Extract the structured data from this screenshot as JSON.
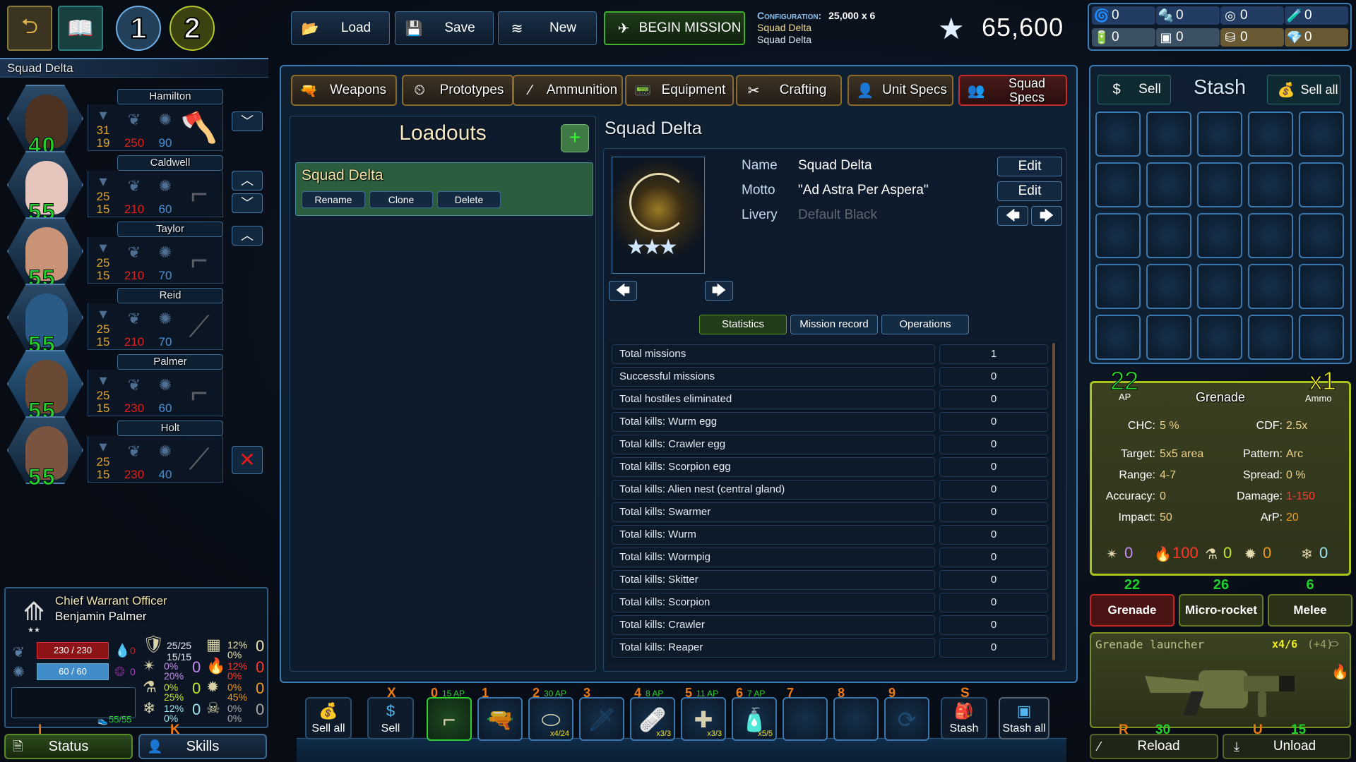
{
  "top_left": {
    "back_icon": "back-arrow-icon",
    "codex_icon": "book-icon",
    "squad_slots": [
      "1",
      "2"
    ]
  },
  "squad": {
    "name": "Squad Delta",
    "soldiers": [
      {
        "name": "Hamilton",
        "level": "40",
        "armor_top": "31",
        "armor_bottom": "19",
        "hp": "250",
        "psi": "90",
        "weapon": "axe",
        "controls": [
          "down"
        ]
      },
      {
        "name": "Caldwell",
        "level": "55",
        "armor_top": "25",
        "armor_bottom": "15",
        "hp": "210",
        "psi": "60",
        "weapon": "assault-rifle",
        "controls": [
          "up",
          "down"
        ]
      },
      {
        "name": "Taylor",
        "level": "55",
        "armor_top": "25",
        "armor_bottom": "15",
        "hp": "210",
        "psi": "70",
        "weapon": "smg",
        "controls": [
          "up"
        ]
      },
      {
        "name": "Reid",
        "level": "55",
        "armor_top": "25",
        "armor_bottom": "15",
        "hp": "210",
        "psi": "70",
        "weapon": "sniper-rifle",
        "controls": []
      },
      {
        "name": "Palmer",
        "level": "55",
        "armor_top": "25",
        "armor_bottom": "15",
        "hp": "230",
        "psi": "60",
        "weapon": "grenade-launcher",
        "controls": [],
        "selected": true
      },
      {
        "name": "Holt",
        "level": "55",
        "armor_top": "25",
        "armor_bottom": "15",
        "hp": "230",
        "psi": "40",
        "weapon": "rifle",
        "controls": [
          "remove"
        ]
      }
    ]
  },
  "officer": {
    "rank": "Chief Warrant Officer",
    "name": "Benjamin Palmer",
    "hp": "230 / 230",
    "psi": "60 / 60",
    "bleed": "0",
    "psi_damage": "0",
    "stamina": "55/55",
    "armor": [
      "25/25",
      "15/15"
    ],
    "resistances": [
      {
        "icon": "grid-icon",
        "a": "12%",
        "b": "0%",
        "v": "0",
        "color": "#f0e6b0"
      },
      {
        "icon": "burst-icon",
        "a": "0%",
        "b": "20%",
        "v": "0",
        "color": "#c38ef0"
      },
      {
        "icon": "fire-icon",
        "a": "12%",
        "b": "0%",
        "v": "0",
        "color": "#ff3a2a"
      },
      {
        "icon": "flask-icon",
        "a": "0%",
        "b": "25%",
        "v": "0",
        "color": "#c6e62a"
      },
      {
        "icon": "virus-icon",
        "a": "0%",
        "b": "45%",
        "v": "0",
        "color": "#f09a1a"
      },
      {
        "icon": "snowflake-icon",
        "a": "12%",
        "b": "0%",
        "v": "0",
        "color": "#9ee6f0"
      },
      {
        "icon": "skull-icon",
        "a": "0%",
        "b": "0%",
        "v": "0",
        "color": "#aaaaaa"
      }
    ]
  },
  "bottom_tabs": {
    "status": {
      "label": "Status",
      "hotkey": "I"
    },
    "skills": {
      "label": "Skills",
      "hotkey": "K"
    }
  },
  "toolbar": {
    "load": "Load",
    "save": "Save",
    "new": "New",
    "begin": "BEGIN MISSION",
    "config_label": "Configuration:",
    "config_value": "25,000 x 6",
    "config_line1": "Squad Delta",
    "config_line2": "Squad Delta",
    "credits": "65,600"
  },
  "resources": [
    {
      "icon": "coil-icon",
      "value": "0"
    },
    {
      "icon": "bolt-icon",
      "value": "0"
    },
    {
      "icon": "ring-icon",
      "value": "0"
    },
    {
      "icon": "potion-icon",
      "value": "0"
    },
    {
      "icon": "battery-icon",
      "value": "0"
    },
    {
      "icon": "chip-icon",
      "value": "0"
    },
    {
      "icon": "canister-icon",
      "value": "0"
    },
    {
      "icon": "crystal-icon",
      "value": "0"
    }
  ],
  "category_tabs": [
    "Weapons",
    "Prototypes",
    "Ammunition",
    "Equipment",
    "Crafting",
    "Unit Specs",
    "Squad Specs"
  ],
  "loadouts": {
    "title": "Loadouts",
    "items": [
      {
        "name": "Squad Delta",
        "rename": "Rename",
        "clone": "Clone",
        "delete": "Delete"
      }
    ]
  },
  "squad_detail": {
    "title": "Squad Delta",
    "name_label": "Name",
    "name_value": "Squad Delta",
    "motto_label": "Motto",
    "motto_value": "\"Ad Astra Per Aspera\"",
    "livery_label": "Livery",
    "livery_value": "Default Black",
    "edit": "Edit",
    "tabs": [
      "Statistics",
      "Mission record",
      "Operations"
    ],
    "stats": [
      {
        "k": "Total missions",
        "v": "1"
      },
      {
        "k": "Successful missions",
        "v": "0"
      },
      {
        "k": "Total hostiles eliminated",
        "v": "0"
      },
      {
        "k": "Total kills: Wurm egg",
        "v": "0"
      },
      {
        "k": "Total kills: Crawler egg",
        "v": "0"
      },
      {
        "k": "Total kills: Scorpion egg",
        "v": "0"
      },
      {
        "k": "Total kills: Alien nest (central gland)",
        "v": "0"
      },
      {
        "k": "Total kills: Swarmer",
        "v": "0"
      },
      {
        "k": "Total kills: Wurm",
        "v": "0"
      },
      {
        "k": "Total kills: Wormpig",
        "v": "0"
      },
      {
        "k": "Total kills: Skitter",
        "v": "0"
      },
      {
        "k": "Total kills: Scorpion",
        "v": "0"
      },
      {
        "k": "Total kills: Crawler",
        "v": "0"
      },
      {
        "k": "Total kills: Reaper",
        "v": "0"
      }
    ]
  },
  "stash": {
    "sell": "Sell",
    "title": "Stash",
    "sell_all": "Sell all"
  },
  "grenade": {
    "ap": "22",
    "ap_label": "AP",
    "name": "Grenade",
    "ammo": "x1",
    "ammo_label": "Ammo",
    "chc_l": "CHC:",
    "chc": "5 %",
    "cdf_l": "CDF:",
    "cdf": "2.5x",
    "target_l": "Target:",
    "target": "5x5 area",
    "pattern_l": "Pattern:",
    "pattern": "Arc",
    "range_l": "Range:",
    "range": "4-7",
    "spread_l": "Spread:",
    "spread": "0 %",
    "accuracy_l": "Accuracy:",
    "accuracy": "0",
    "damage_l": "Damage:",
    "damage": "1-150",
    "impact_l": "Impact:",
    "impact": "50",
    "arp_l": "ArP:",
    "arp": "20",
    "dmg_types": [
      {
        "icon": "burst-icon",
        "v": "0",
        "color": "#c38ef0"
      },
      {
        "icon": "fire-icon",
        "v": "100",
        "color": "#ff3a2a"
      },
      {
        "icon": "flask-icon",
        "v": "0",
        "color": "#c6e62a"
      },
      {
        "icon": "virus-icon",
        "v": "0",
        "color": "#f09a1a"
      },
      {
        "icon": "snowflake-icon",
        "v": "0",
        "color": "#9ee6f0"
      }
    ]
  },
  "attack_modes": [
    {
      "label": "Grenade",
      "ap": "22",
      "active": true
    },
    {
      "label": "Micro-rocket",
      "ap": "26"
    },
    {
      "label": "Melee",
      "ap": "6"
    }
  ],
  "weapon": {
    "name": "Grenade launcher",
    "ammo": "x4/6",
    "bonus": "(+4)",
    "reload": "Reload",
    "reload_key": "R",
    "reload_ap": "30",
    "unload": "Unload",
    "unload_key": "U",
    "unload_ap": "15"
  },
  "quickbar": {
    "sell_all": "Sell all",
    "sell": "Sell",
    "sell_key": "X",
    "stash": "Stash",
    "stash_key": "S",
    "stash_all": "Stash all",
    "slots": [
      {
        "num": "0",
        "ap": "15 AP",
        "icon": "grenade-launcher-icon",
        "count": "",
        "active": true
      },
      {
        "num": "1",
        "ap": "",
        "icon": "pistol-icon",
        "count": ""
      },
      {
        "num": "2",
        "ap": "30 AP",
        "icon": "grenade-round-icon",
        "count": "x4/24"
      },
      {
        "num": "3",
        "ap": "",
        "icon": "knife-icon",
        "count": ""
      },
      {
        "num": "4",
        "ap": "8 AP",
        "icon": "medkit-icon",
        "count": "x3/3"
      },
      {
        "num": "5",
        "ap": "11 AP",
        "icon": "medbox-icon",
        "count": "x3/3"
      },
      {
        "num": "6",
        "ap": "7 AP",
        "icon": "water-bottle-icon",
        "count": "x5/5"
      },
      {
        "num": "7",
        "ap": "",
        "icon": "",
        "count": ""
      },
      {
        "num": "8",
        "ap": "",
        "icon": "",
        "count": ""
      },
      {
        "num": "9",
        "ap": "",
        "icon": "swap-icon",
        "count": ""
      }
    ]
  },
  "colors": {
    "accent_green": "#2bd12f",
    "hotkey_orange": "#f07a12",
    "panel_blue": "#3d7bb0",
    "weapon_olive": "#a8c41a"
  }
}
